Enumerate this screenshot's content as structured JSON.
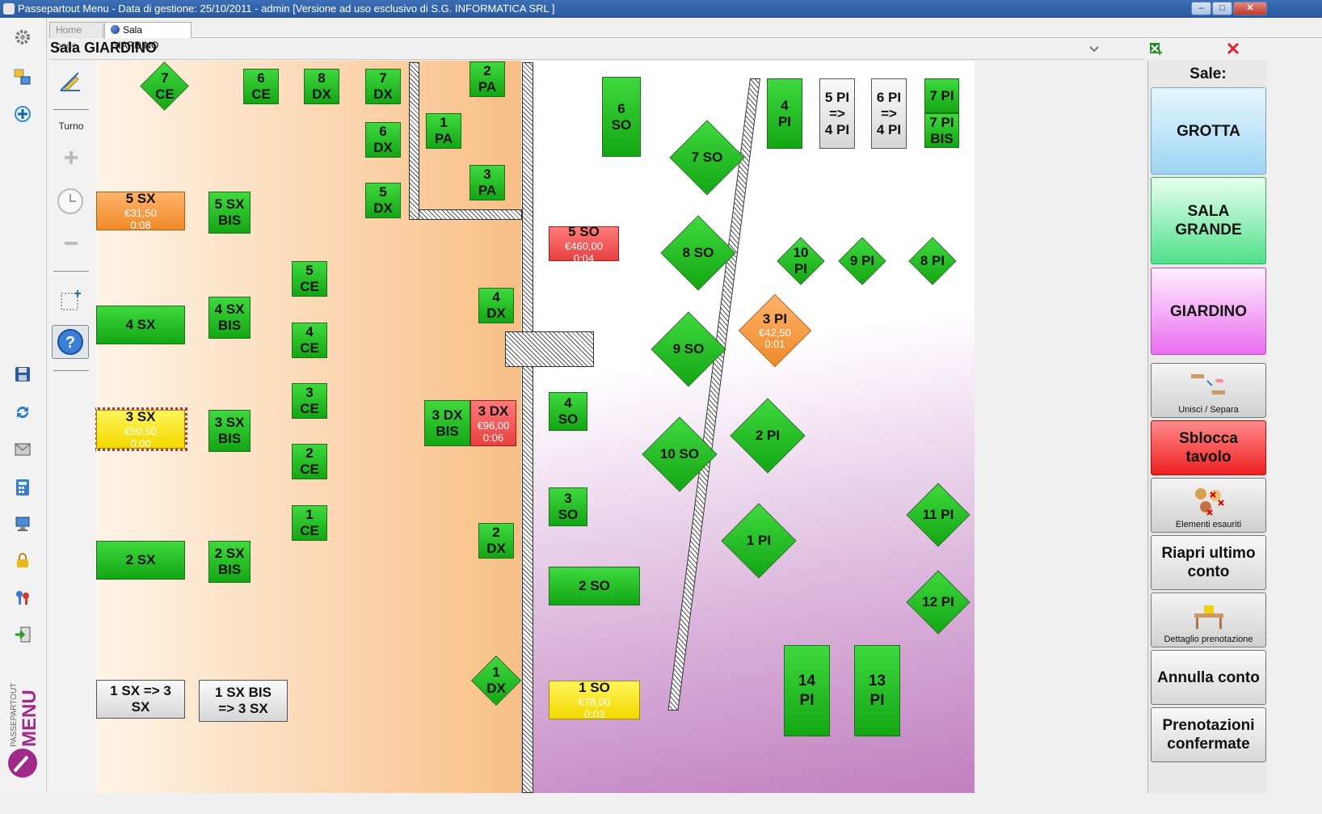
{
  "window": {
    "title": "Passepartout Menu - Data di gestione: 25/10/2011 - admin [Versione ad uso esclusivo di S.G. INFORMATICA SRL ]",
    "minimize": "–",
    "maximize": "□",
    "close": "✕"
  },
  "tabs": [
    {
      "label": "Home page",
      "active": false
    },
    {
      "label": "Sala GIARDINO",
      "active": true
    }
  ],
  "room": {
    "title": "Sala GIARDINO",
    "collapse_icon": "chevron-down-icon",
    "excel_icon": "excel-export-icon",
    "close_icon": "close-icon"
  },
  "left_toolbar_icons": [
    "gear-icon",
    "switch-icon",
    "add-icon",
    "save-icon",
    "refresh-icon",
    "email-icon",
    "calculator-icon",
    "network-icon",
    "lock-icon",
    "keys-icon",
    "exit-icon"
  ],
  "brand": {
    "line1": "PASSEPARTOUT",
    "line2": "MENU"
  },
  "tools": {
    "turno_label": "Turno",
    "icons": [
      "edit-layout-icon",
      "plus-icon",
      "clock-icon",
      "minus-icon",
      "select-area-icon",
      "help-icon"
    ]
  },
  "colors": {
    "free": "#22c022",
    "busy_orange": "#f39a3e",
    "busy_red": "#f05656",
    "busy_yellow": "#f7e21a",
    "merged_gray": "#e6e6e6"
  },
  "tables": {
    "t_7ce": {
      "label": "7\nCE"
    },
    "t_6ce": {
      "label": "6\nCE"
    },
    "t_8dx": {
      "label": "8\nDX"
    },
    "t_7dx": {
      "label": "7\nDX"
    },
    "t_6dx": {
      "label": "6\nDX"
    },
    "t_5dx": {
      "label": "5\nDX"
    },
    "t_2pa": {
      "label": "2\nPA"
    },
    "t_1pa": {
      "label": "1\nPA"
    },
    "t_3pa": {
      "label": "3\nPA"
    },
    "t_5sx": {
      "label": "5 SX",
      "amount": "€31,50",
      "time": "0:08"
    },
    "t_5sxbis": {
      "label": "5 SX\nBIS"
    },
    "t_5ce": {
      "label": "5\nCE"
    },
    "t_4sx": {
      "label": "4 SX"
    },
    "t_4sxbis": {
      "label": "4 SX\nBIS"
    },
    "t_4ce": {
      "label": "4\nCE"
    },
    "t_4dx": {
      "label": "4\nDX"
    },
    "t_3sx": {
      "label": "3 SX",
      "amount": "€50,50",
      "time": "0:00"
    },
    "t_3sxbis": {
      "label": "3 SX\nBIS"
    },
    "t_3ce": {
      "label": "3\nCE"
    },
    "t_3dxbis": {
      "label": "3 DX\nBIS"
    },
    "t_3dx": {
      "label": "3 DX",
      "amount": "€96,00",
      "time": "0:06"
    },
    "t_2ce": {
      "label": "2\nCE"
    },
    "t_1ce": {
      "label": "1\nCE"
    },
    "t_2sx": {
      "label": "2 SX"
    },
    "t_2sxbis": {
      "label": "2 SX\nBIS"
    },
    "t_2dx": {
      "label": "2\nDX"
    },
    "t_1dx": {
      "label": "1\nDX"
    },
    "t_1sx3": {
      "label": "1 SX => 3\nSX"
    },
    "t_1sxbis3": {
      "label": "1 SX BIS\n=> 3 SX"
    },
    "t_6so": {
      "label": "6\nSO"
    },
    "t_7so": {
      "label": "7 SO"
    },
    "t_5so": {
      "label": "5 SO",
      "amount": "€460,00",
      "time": "0:04"
    },
    "t_8so": {
      "label": "8 SO"
    },
    "t_9so": {
      "label": "9 SO"
    },
    "t_4so": {
      "label": "4\nSO"
    },
    "t_10so": {
      "label": "10 SO"
    },
    "t_3so": {
      "label": "3\nSO"
    },
    "t_2so": {
      "label": "2 SO"
    },
    "t_1so": {
      "label": "1 SO",
      "amount": "€78,00",
      "time": "0:03"
    },
    "t_4pi": {
      "label": "4\nPI"
    },
    "t_5pi4": {
      "label": "5 PI\n=>\n4 PI"
    },
    "t_6pi4": {
      "label": "6 PI\n=>\n4 PI"
    },
    "t_7pi": {
      "label": "7 PI"
    },
    "t_7pibis": {
      "label": "7 PI\nBIS"
    },
    "t_10pi": {
      "label": "10\nPI"
    },
    "t_9pi": {
      "label": "9 PI"
    },
    "t_8pi": {
      "label": "8 PI"
    },
    "t_3pi": {
      "label": "3 PI",
      "amount": "€42,50",
      "time": "0:01"
    },
    "t_2pi": {
      "label": "2 PI"
    },
    "t_1pi": {
      "label": "1 PI"
    },
    "t_11pi": {
      "label": "11 PI"
    },
    "t_12pi": {
      "label": "12 PI"
    },
    "t_14pi": {
      "label": "14\nPI"
    },
    "t_13pi": {
      "label": "13\nPI"
    }
  },
  "right_panel": {
    "sale_label": "Sale:",
    "rooms": [
      "GROTTA",
      "SALA\nGRANDE",
      "GIARDINO"
    ],
    "unisci_separa": "Unisci / Separa",
    "sblocca_tavolo": "Sblocca\ntavolo",
    "elementi_esauriti": "Elementi esauriti",
    "riapri_ultimo_conto": "Riapri ultimo\nconto",
    "dettaglio_prenotazione": "Dettaglio prenotazione",
    "annulla_conto": "Annulla conto",
    "prenotazioni_confermate": "Prenotazioni\nconfermate"
  }
}
